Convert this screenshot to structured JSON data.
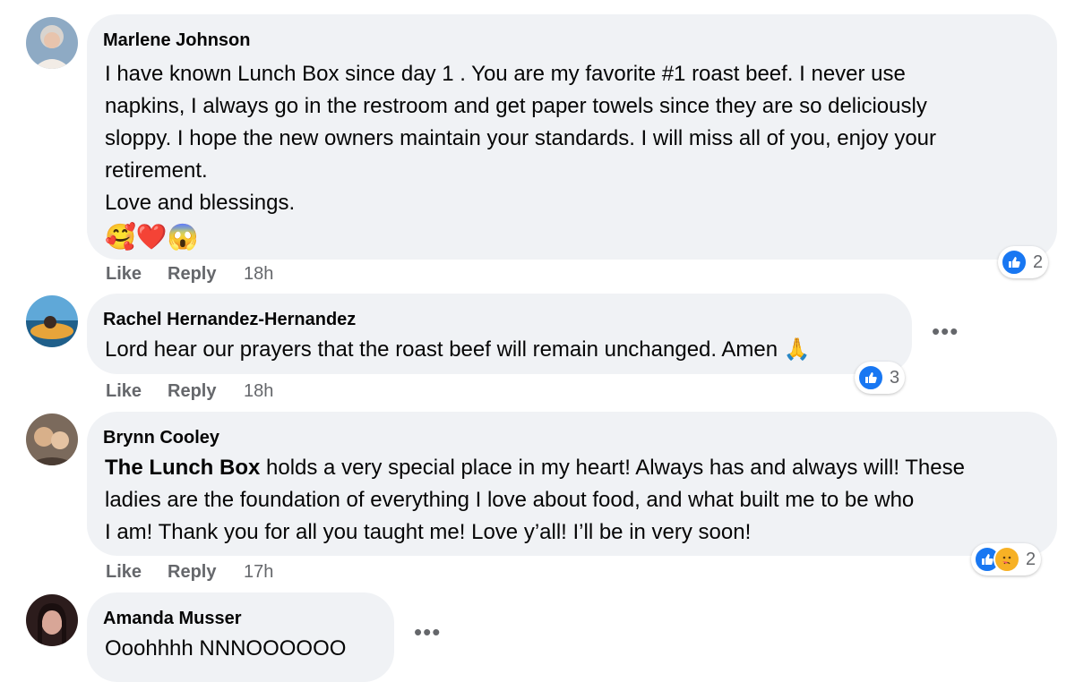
{
  "comments": [
    {
      "author": "Marlene Johnson",
      "text": "I have known Lunch Box since day 1 . You are my favorite #1 roast beef. I never use\nnapkins, I always go in the restroom and get paper towels since they are so deliciously\nsloppy. I hope the new owners maintain your standards. I will miss all of you, enjoy your\nretirement.\nLove and blessings.",
      "emojis": "🥰❤️😱",
      "like_label": "Like",
      "reply_label": "Reply",
      "time": "18h",
      "reaction_count": "2",
      "avatar_colors": [
        "#7a9bb8",
        "#e8d9cc"
      ]
    },
    {
      "author": "Rachel Hernandez-Hernandez",
      "text": "Lord hear our prayers that the roast beef will remain unchanged. Amen 🙏",
      "like_label": "Like",
      "reply_label": "Reply",
      "time": "18h",
      "reaction_count": "3",
      "more_icon": "more-options-icon",
      "avatar_colors": [
        "#2f7fb5",
        "#d99a2b"
      ]
    },
    {
      "author": "Brynn Cooley",
      "mention": "The Lunch Box",
      "text": " holds a very special place in my heart! Always has and always will! These\nladies are the foundation of everything I love about food, and what built me to be who\nI am! Thank you for all you taught me! Love y’all! I’ll be in very soon!",
      "like_label": "Like",
      "reply_label": "Reply",
      "time": "17h",
      "reaction_count": "2",
      "avatar_colors": [
        "#6b5a4e",
        "#d9b48f"
      ]
    },
    {
      "author": "Amanda Musser",
      "text": "Ooohhhh NNNOOOOOO",
      "more_icon": "more-options-icon",
      "avatar_colors": [
        "#2c1c1c",
        "#c48a7a"
      ]
    }
  ],
  "colors": {
    "bubble": "#f0f2f5",
    "like_blue": "#1877f2",
    "meta_gray": "#65676b"
  }
}
